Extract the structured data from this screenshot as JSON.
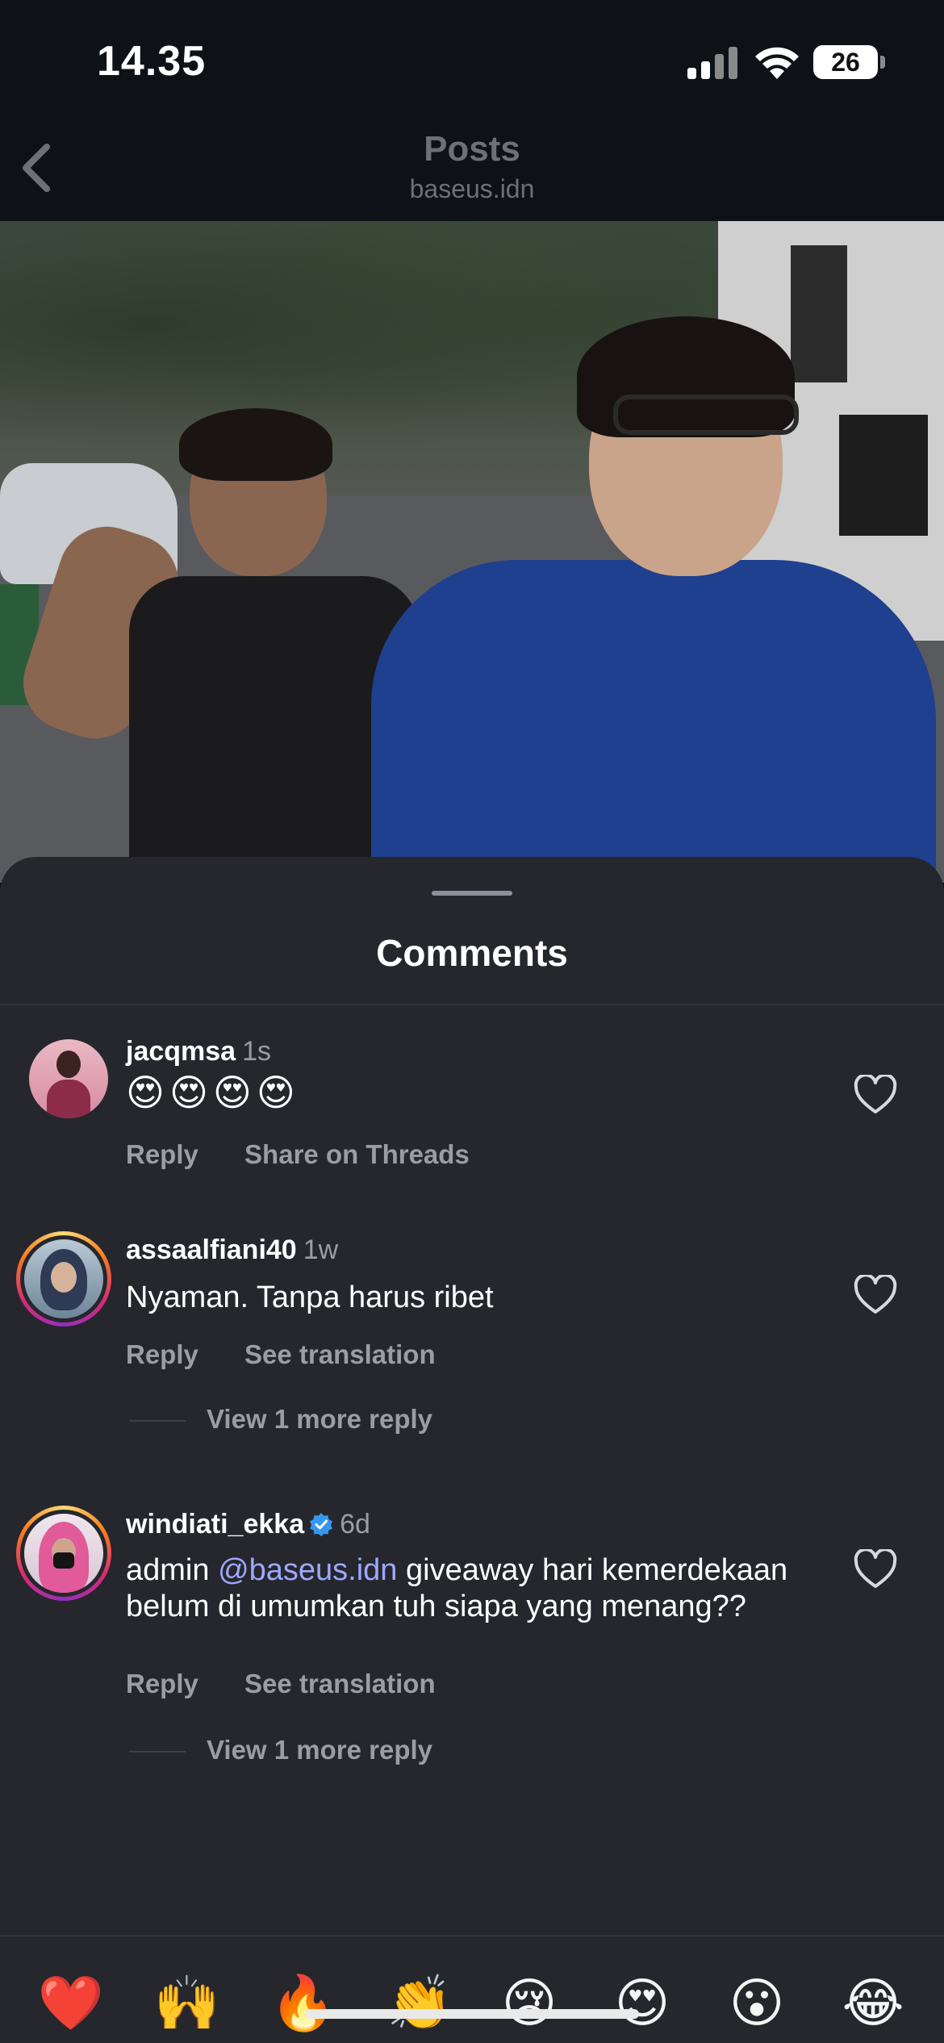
{
  "status_bar": {
    "time": "14.35",
    "battery": "26"
  },
  "header": {
    "title": "Posts",
    "subtitle": "baseus.idn"
  },
  "sheet": {
    "title": "Comments"
  },
  "comments": [
    {
      "username": "jacqmsa",
      "time": "1s",
      "text": "😍😍😍😍",
      "actions": [
        "Reply",
        "Share on Threads"
      ],
      "more_replies": ""
    },
    {
      "username": "assaalfiani40",
      "time": "1w",
      "text": "Nyaman. Tanpa harus ribet",
      "actions": [
        "Reply",
        "See translation"
      ],
      "more_replies": "View 1 more reply"
    },
    {
      "username": "windiati_ekka",
      "verified": true,
      "time": "6d",
      "text_prefix": "admin ",
      "mention": "@baseus.idn",
      "text_suffix": " giveaway hari kemerdekaan belum di umumkan tuh siapa yang menang??",
      "actions": [
        "Reply",
        "See translation"
      ],
      "more_replies": "View 1 more reply"
    }
  ],
  "reactions": [
    "❤️",
    "🙌",
    "🔥",
    "👏",
    "😢",
    "😍",
    "😮",
    "😂"
  ],
  "colors": {
    "accent_mention": "#9ea8ff",
    "sheet_bg": "#25272d",
    "verified": "#3797f0"
  }
}
